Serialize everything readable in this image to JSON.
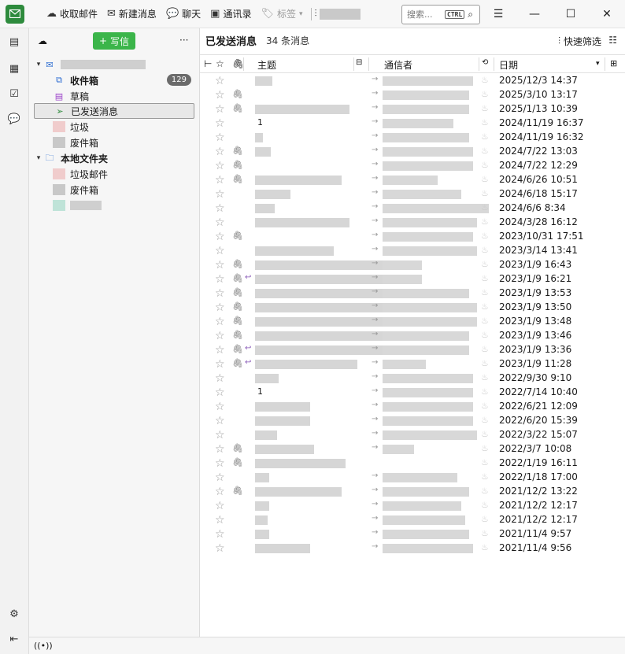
{
  "toolbar": {
    "get_mail": "收取邮件",
    "new_message": "新建消息",
    "chat": "聊天",
    "address_book": "通讯录",
    "tag": "标签",
    "search_placeholder": "搜索...",
    "search_shortcut": "CTRL"
  },
  "window": {
    "minimize": "—",
    "maximize": "☐",
    "close": "✕"
  },
  "folder_pane": {
    "compose_label": "写信",
    "more": "···",
    "inbox": "收件箱",
    "inbox_count": "129",
    "drafts": "草稿",
    "sent": "已发送消息",
    "junk": "垃圾",
    "trash": "废件箱",
    "local_folders": "本地文件夹",
    "local_junk": "垃圾邮件",
    "local_trash": "废件箱"
  },
  "thread_pane": {
    "title": "已发送消息",
    "count": "34 条消息",
    "quick_filter": "快速筛选",
    "col_subject": "主题",
    "col_correspondent": "通信者",
    "col_date": "日期"
  },
  "messages": [
    {
      "date": "2025/12/3 14:37",
      "clip": false,
      "reply": false,
      "subj": ""
    },
    {
      "date": "2025/3/10 13:17",
      "clip": true,
      "reply": false,
      "subj": ""
    },
    {
      "date": "2025/1/13 10:39",
      "clip": true,
      "reply": false,
      "subj": ""
    },
    {
      "date": "2024/11/19 16:37",
      "clip": false,
      "reply": false,
      "subj": "1"
    },
    {
      "date": "2024/11/19 16:32",
      "clip": false,
      "reply": false,
      "subj": ""
    },
    {
      "date": "2024/7/22 13:03",
      "clip": true,
      "reply": false,
      "subj": ""
    },
    {
      "date": "2024/7/22 12:29",
      "clip": true,
      "reply": false,
      "subj": ""
    },
    {
      "date": "2024/6/26 10:51",
      "clip": true,
      "reply": false,
      "subj": ""
    },
    {
      "date": "2024/6/18 15:17",
      "clip": false,
      "reply": false,
      "subj": ""
    },
    {
      "date": "2024/6/6 8:34",
      "clip": false,
      "reply": false,
      "subj": ""
    },
    {
      "date": "2024/3/28 16:12",
      "clip": false,
      "reply": false,
      "subj": ""
    },
    {
      "date": "2023/10/31 17:51",
      "clip": true,
      "reply": false,
      "subj": ""
    },
    {
      "date": "2023/3/14 13:41",
      "clip": false,
      "reply": false,
      "subj": ""
    },
    {
      "date": "2023/1/9 16:43",
      "clip": true,
      "reply": false,
      "subj": ""
    },
    {
      "date": "2023/1/9 16:21",
      "clip": true,
      "reply": true,
      "subj": ""
    },
    {
      "date": "2023/1/9 13:53",
      "clip": true,
      "reply": false,
      "subj": ""
    },
    {
      "date": "2023/1/9 13:50",
      "clip": true,
      "reply": false,
      "subj": ""
    },
    {
      "date": "2023/1/9 13:48",
      "clip": true,
      "reply": false,
      "subj": ""
    },
    {
      "date": "2023/1/9 13:46",
      "clip": true,
      "reply": false,
      "subj": ""
    },
    {
      "date": "2023/1/9 13:36",
      "clip": true,
      "reply": true,
      "subj": ""
    },
    {
      "date": "2023/1/9 11:28",
      "clip": true,
      "reply": true,
      "subj": ""
    },
    {
      "date": "2022/9/30 9:10",
      "clip": false,
      "reply": false,
      "subj": ""
    },
    {
      "date": "2022/7/14 10:40",
      "clip": false,
      "reply": false,
      "subj": "1"
    },
    {
      "date": "2022/6/21 12:09",
      "clip": false,
      "reply": false,
      "subj": ""
    },
    {
      "date": "2022/6/20 15:39",
      "clip": false,
      "reply": false,
      "subj": ""
    },
    {
      "date": "2022/3/22 15:07",
      "clip": false,
      "reply": false,
      "subj": ""
    },
    {
      "date": "2022/3/7 10:08",
      "clip": true,
      "reply": false,
      "subj": ""
    },
    {
      "date": "2022/1/19 16:11",
      "clip": true,
      "reply": false,
      "subj": ""
    },
    {
      "date": "2022/1/18 17:00",
      "clip": false,
      "reply": false,
      "subj": ""
    },
    {
      "date": "2021/12/2 13:22",
      "clip": true,
      "reply": false,
      "subj": ""
    },
    {
      "date": "2021/12/2 12:17",
      "clip": false,
      "reply": false,
      "subj": ""
    },
    {
      "date": "2021/12/2 12:17",
      "clip": false,
      "reply": false,
      "subj": ""
    },
    {
      "date": "2021/11/4 9:57",
      "clip": false,
      "reply": false,
      "subj": ""
    },
    {
      "date": "2021/11/4 9:56",
      "clip": false,
      "reply": false,
      "subj": ""
    }
  ],
  "colors": {
    "accent": "#3bb54a",
    "app_icon": "#2e8b3d",
    "reply": "#8a5bb8"
  }
}
